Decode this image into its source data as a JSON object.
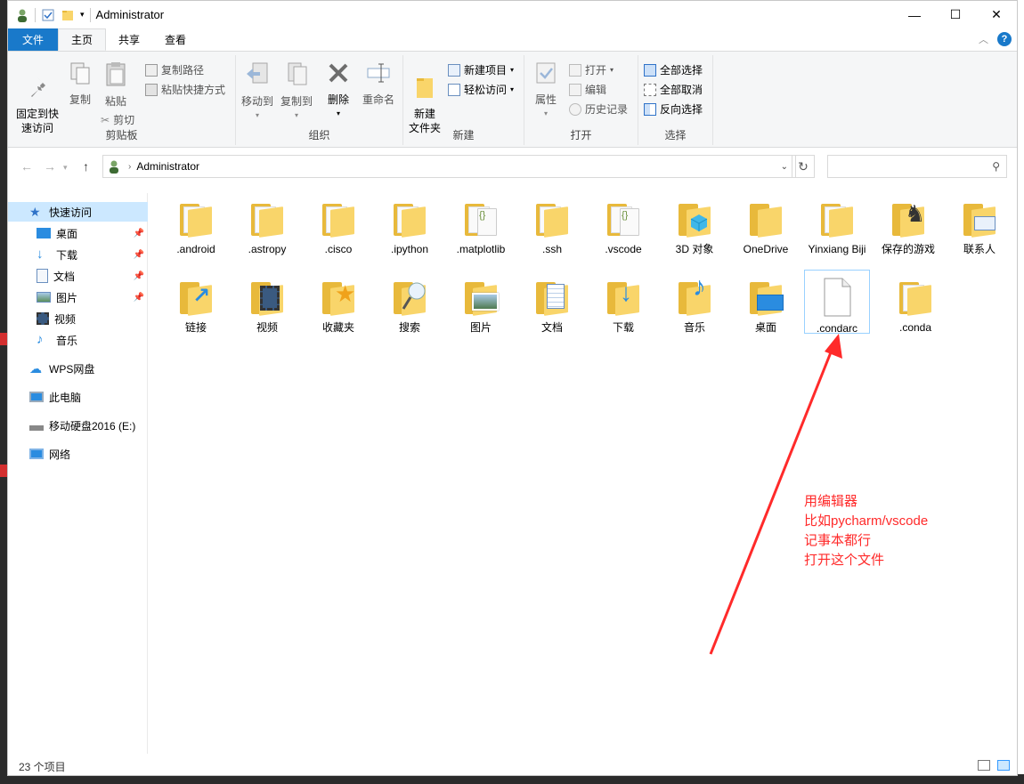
{
  "window": {
    "title": "Administrator",
    "controls": {
      "minimize": "—",
      "maximize": "☐",
      "close": "✕"
    }
  },
  "ribbon": {
    "tabs": [
      {
        "label": "文件"
      },
      {
        "label": "主页"
      },
      {
        "label": "共享"
      },
      {
        "label": "查看"
      }
    ],
    "help": "?",
    "groups": {
      "clipboard": {
        "label": "剪贴板",
        "pin": "固定到快\n速访问",
        "copy": "复制",
        "paste": "粘贴",
        "copy_path": "复制路径",
        "paste_shortcut": "粘贴快捷方式",
        "cut": "剪切"
      },
      "organize": {
        "label": "组织",
        "move_to": "移动到",
        "copy_to": "复制到",
        "delete": "删除",
        "rename": "重命名"
      },
      "new": {
        "label": "新建",
        "new_folder": "新建\n文件夹",
        "new_item": "新建项目",
        "easy_access": "轻松访问"
      },
      "open": {
        "label": "打开",
        "properties": "属性",
        "open": "打开",
        "edit": "编辑",
        "history": "历史记录"
      },
      "select": {
        "label": "选择",
        "select_all": "全部选择",
        "select_none": "全部取消",
        "invert": "反向选择"
      }
    }
  },
  "address": {
    "path": "Administrator",
    "search_placeholder": ""
  },
  "nav": {
    "items": [
      {
        "label": "快速访问",
        "icon": "star-icon",
        "selected": true
      },
      {
        "label": "桌面",
        "icon": "desktop-icon",
        "pinned": true
      },
      {
        "label": "下载",
        "icon": "download-icon",
        "pinned": true
      },
      {
        "label": "文档",
        "icon": "document-icon",
        "pinned": true
      },
      {
        "label": "图片",
        "icon": "picture-icon",
        "pinned": true
      },
      {
        "label": "视频",
        "icon": "video-icon"
      },
      {
        "label": "音乐",
        "icon": "music-icon"
      },
      {
        "label": "WPS网盘",
        "icon": "cloud-icon"
      },
      {
        "label": "此电脑",
        "icon": "computer-icon"
      },
      {
        "label": "移动硬盘2016 (E:)",
        "icon": "drive-icon"
      },
      {
        "label": "网络",
        "icon": "network-icon"
      }
    ]
  },
  "files": [
    {
      "name": ".android",
      "type": "folder"
    },
    {
      "name": ".astropy",
      "type": "folder"
    },
    {
      "name": ".cisco",
      "type": "folder"
    },
    {
      "name": ".ipython",
      "type": "folder"
    },
    {
      "name": ".matplotlib",
      "type": "folder-code"
    },
    {
      "name": ".ssh",
      "type": "folder"
    },
    {
      "name": ".vscode",
      "type": "folder-code"
    },
    {
      "name": "3D 对象",
      "type": "3d-folder"
    },
    {
      "name": "OneDrive",
      "type": "folder-plain"
    },
    {
      "name": "Yinxiang Biji",
      "type": "folder"
    },
    {
      "name": "保存的游戏",
      "type": "games-folder"
    },
    {
      "name": "联系人",
      "type": "contacts-folder"
    },
    {
      "name": "链接",
      "type": "links-folder"
    },
    {
      "name": "视频",
      "type": "videos-folder"
    },
    {
      "name": "收藏夹",
      "type": "favorites-folder"
    },
    {
      "name": "搜索",
      "type": "search-folder"
    },
    {
      "name": "图片",
      "type": "pictures-folder"
    },
    {
      "name": "文档",
      "type": "documents-folder"
    },
    {
      "name": "下载",
      "type": "downloads-folder"
    },
    {
      "name": "音乐",
      "type": "music-folder"
    },
    {
      "name": "桌面",
      "type": "desktop-folder"
    },
    {
      "name": ".condarc",
      "type": "file",
      "selected": true
    },
    {
      "name": ".conda",
      "type": "folder-plain"
    }
  ],
  "annotation": {
    "lines": [
      "用编辑器",
      "比如pycharm/vscode",
      "记事本都行",
      "打开这个文件"
    ],
    "color": "#ff2a2a"
  },
  "status": {
    "count": "23 个项目"
  },
  "colors": {
    "accent": "#1979ca",
    "selection": "#cce8ff",
    "folder": "#f9d56a"
  }
}
